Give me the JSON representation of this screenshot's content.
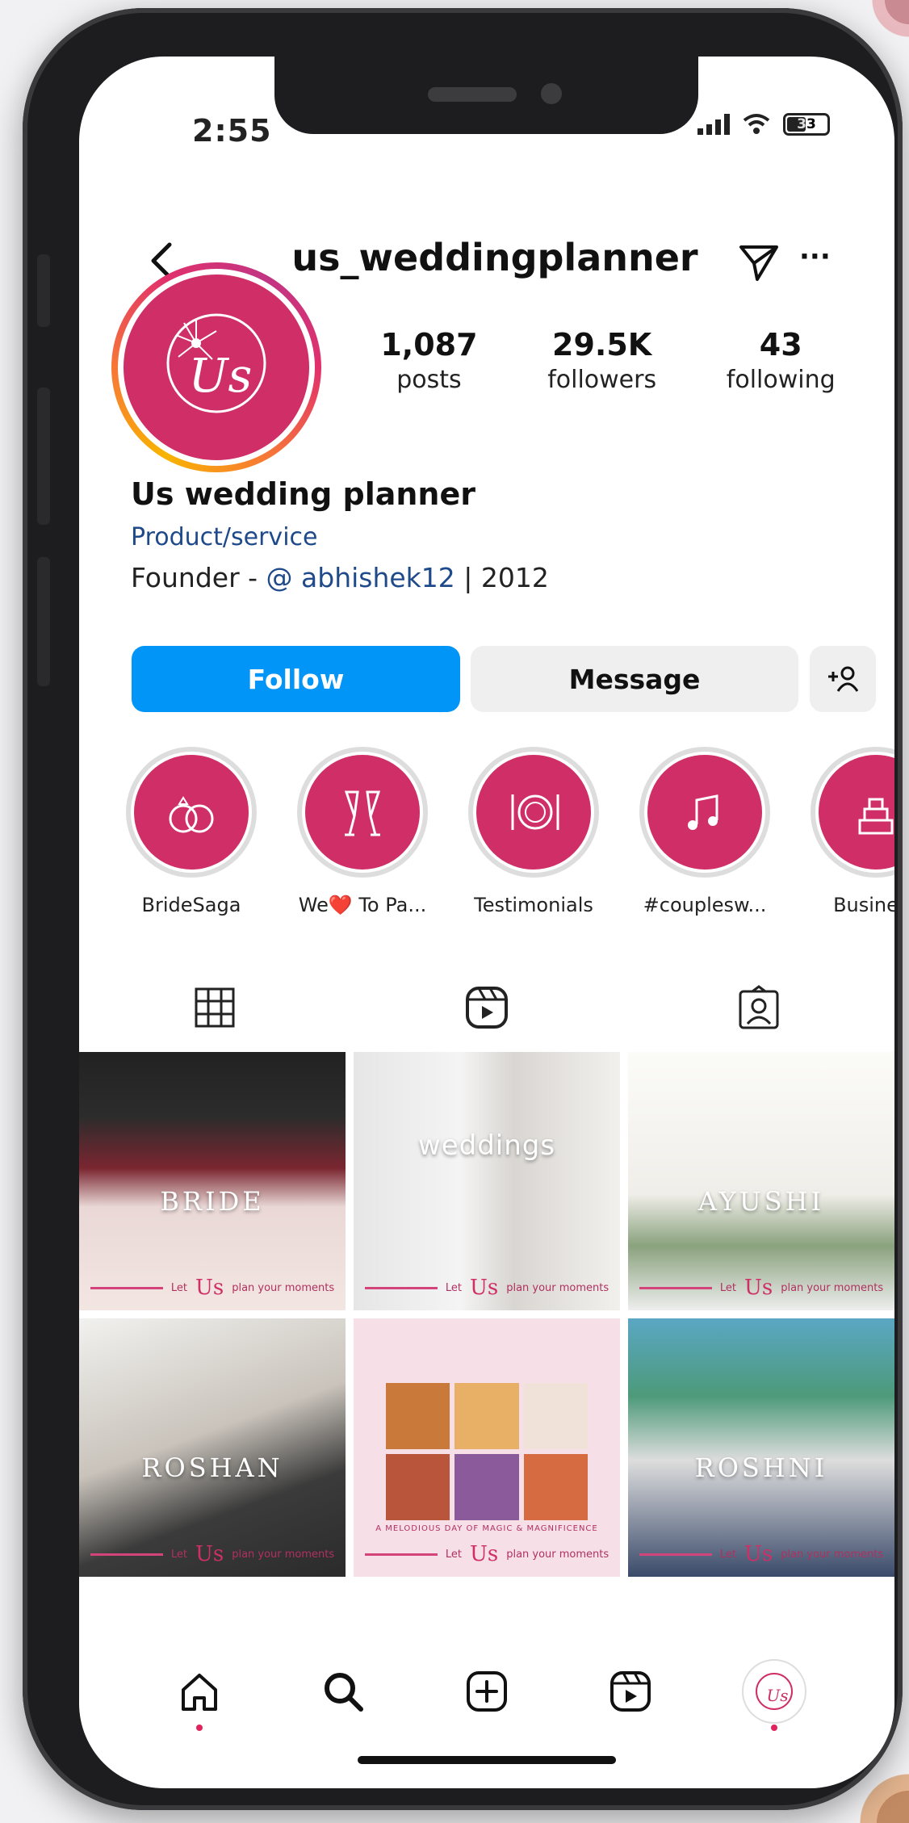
{
  "status": {
    "time": "2:55",
    "battery": "33"
  },
  "header": {
    "username": "us_weddingplanner"
  },
  "profile": {
    "avatar_text": "Us",
    "posts_count": "1,087",
    "posts_label": "posts",
    "followers_count": "29.5K",
    "followers_label": "followers",
    "following_count": "43",
    "following_label": "following",
    "display_name": "Us wedding planner",
    "category": "Product/service",
    "bio_prefix": "Founder - ",
    "bio_mention": "@ abhishek12",
    "bio_suffix": " | 2012"
  },
  "actions": {
    "follow": "Follow",
    "message": "Message",
    "add_user": "+☺"
  },
  "highlights": [
    {
      "label": "BrideSaga",
      "icon": "rings-icon"
    },
    {
      "label": "We❤️ To Pa...",
      "icon": "champagne-icon"
    },
    {
      "label": "Testimonials",
      "icon": "plate-icon"
    },
    {
      "label": "#couplesw...",
      "icon": "music-icon"
    },
    {
      "label": "Business",
      "icon": "cake-icon"
    }
  ],
  "tabs": [
    {
      "icon": "grid-icon"
    },
    {
      "icon": "reels-icon"
    },
    {
      "icon": "tagged-icon"
    }
  ],
  "posts": [
    {
      "title": "BRIDE",
      "footer": "plan your moments"
    },
    {
      "title": "weddings",
      "footer": "plan your moments"
    },
    {
      "title": "AYUSHI",
      "footer": "plan your moments"
    },
    {
      "title": "ROSHAN",
      "footer": "plan your moments"
    },
    {
      "title": "",
      "caption": "A MELODIOUS DAY OF MAGIC & MAGNIFICENCE",
      "footer": "plan your moments"
    },
    {
      "title": "ROSHNI",
      "footer": "plan your moments"
    }
  ],
  "footer_logo": "Us",
  "footer_let": "Let",
  "colors": {
    "brand": "#cf2f66",
    "follow": "#0095f6",
    "link": "#1f4a8a"
  },
  "bottom_nav": [
    "home-icon",
    "search-icon",
    "create-icon",
    "reels-icon",
    "profile-icon"
  ]
}
